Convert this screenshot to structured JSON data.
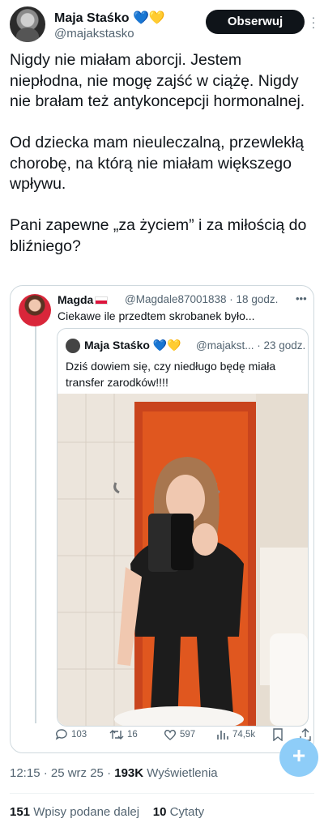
{
  "author": {
    "name": "Maja Staśko",
    "handle": "@majakstasko",
    "follow_label": "Obserwuj"
  },
  "tweet": {
    "paragraphs": [
      "Nigdy nie miałam aborcji. Jestem niepłodna, nie mogę zajść w ciążę. Nigdy nie brałam też antykoncepcji hormonalnej.",
      "Od dziecka mam nieuleczalną, przewlekłą chorobę, na którą nie miałam większego wpływu.",
      "Pani zapewne „za życiem” i za miłością do bliźniego?"
    ]
  },
  "quoted": {
    "name": "Magda",
    "handle_time": "@Magdale87001838 · 18 godz.",
    "text": "Ciekawe ile przedtem skrobanek było...",
    "inner": {
      "name": "Maja Staśko",
      "handle_time": "@majakst... · 23 godz.",
      "text": "Dziś dowiem się, czy niedługo będę miała transfer zarodków!!!!"
    },
    "actions": {
      "replies": "103",
      "retweets": "16",
      "likes": "597",
      "views": "74,5k"
    }
  },
  "meta": {
    "time_date": "12:15 · 25 wrz 25 · ",
    "views_count": "193K",
    "views_label": " Wyświetlenia"
  },
  "stats": {
    "reposts_count": "151",
    "reposts_label": " Wpisy podane dalej",
    "quotes_count": "10",
    "quotes_label": " Cytaty"
  },
  "colors": {
    "heart_blue": "#2a7de1",
    "heart_yellow": "#f1c21b",
    "text_secondary": "#536471"
  }
}
